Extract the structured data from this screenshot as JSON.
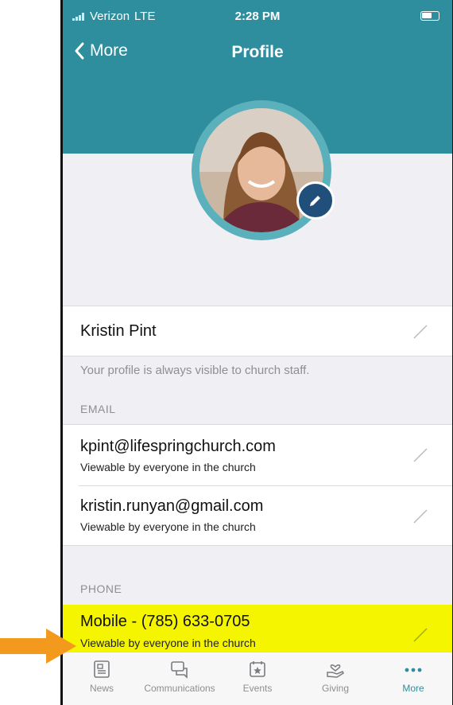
{
  "status_bar": {
    "carrier": "Verizon",
    "network": "LTE",
    "time": "2:28 PM"
  },
  "nav": {
    "back_label": "More",
    "title": "Profile"
  },
  "profile": {
    "name": "Kristin Pint",
    "visibility_note": "Your profile is always visible to church staff."
  },
  "email": {
    "section_label": "EMAIL",
    "items": [
      {
        "value": "kpint@lifespringchurch.com",
        "visibility": "Viewable by everyone in the church"
      },
      {
        "value": "kristin.runyan@gmail.com",
        "visibility": "Viewable by everyone in the church"
      }
    ]
  },
  "phone": {
    "section_label": "PHONE",
    "items": [
      {
        "value": "Mobile - (785) 633-0705",
        "visibility": "Viewable by everyone in the church",
        "highlight_color": "#f5f500"
      }
    ]
  },
  "tabs": [
    {
      "label": "News",
      "icon": "news-icon"
    },
    {
      "label": "Communications",
      "icon": "chat-icon"
    },
    {
      "label": "Events",
      "icon": "calendar-star-icon"
    },
    {
      "label": "Giving",
      "icon": "giving-hand-heart-icon"
    },
    {
      "label": "More",
      "icon": "more-dots-icon",
      "active": true
    }
  ],
  "colors": {
    "header": "#2e8e9e",
    "accent": "#2e8e9e",
    "edit_badge": "#1f4f7a",
    "arrow": "#f39a1e"
  }
}
